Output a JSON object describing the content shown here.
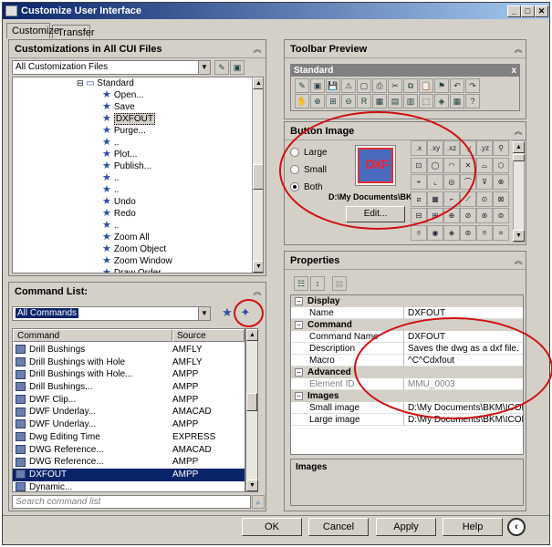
{
  "window": {
    "title": "Customize User Interface",
    "min": "_",
    "max": "□",
    "close": "✕"
  },
  "tabs": [
    "Customize",
    "Transfer"
  ],
  "customizations": {
    "header": "Customizations in All CUI Files",
    "file_combo": "All Customization Files",
    "tree_root": "Standard",
    "tree_items": [
      "Open...",
      "Save",
      "DXFOUT",
      "Purge...",
      "..",
      "Plot...",
      "Publish...",
      "..",
      "..",
      "Undo",
      "Redo",
      "..",
      "Zoom All",
      "Zoom Object",
      "Zoom Window",
      "Draw Order"
    ],
    "selected_index": 2
  },
  "command_list": {
    "header": "Command List:",
    "filter_combo": "All Commands",
    "col_command": "Command",
    "col_source": "Source",
    "rows": [
      {
        "command": "Drill Bushings",
        "source": "AMFLY"
      },
      {
        "command": "Drill Bushings with Hole",
        "source": "AMFLY"
      },
      {
        "command": "Drill Bushings with Hole...",
        "source": "AMPP"
      },
      {
        "command": "Drill Bushings...",
        "source": "AMPP"
      },
      {
        "command": "DWF Clip...",
        "source": "AMPP"
      },
      {
        "command": "DWF Underlay...",
        "source": "AMACAD"
      },
      {
        "command": "DWF Underlay...",
        "source": "AMPP"
      },
      {
        "command": "Dwg Editing Time",
        "source": "EXPRESS"
      },
      {
        "command": "DWG Reference...",
        "source": "AMACAD"
      },
      {
        "command": "DWG Reference...",
        "source": "AMPP"
      },
      {
        "command": "DXFOUT",
        "source": "AMPP"
      },
      {
        "command": "Dynamic...",
        "source": ""
      }
    ],
    "selected_index": 10,
    "search_placeholder": "Search command list"
  },
  "toolbar_preview": {
    "header": "Toolbar Preview",
    "toolbar_name": "Standard",
    "close": "x",
    "icons": [
      "new-icon",
      "open-icon",
      "save-icon",
      "plot-icon",
      "preview-icon",
      "publish-icon",
      "cut-icon",
      "copy-icon",
      "paste-icon",
      "matchprop-icon",
      "undo-icon",
      "redo-icon",
      "pan-icon",
      "zoom-realtime-icon",
      "zoom-window-icon",
      "zoom-prev-icon",
      "regen-icon",
      "sheetset-icon",
      "properties-icon",
      "designcenter-icon",
      "toolpalette-icon",
      "markup-icon",
      "calc-icon",
      "help-icon"
    ]
  },
  "button_image": {
    "header": "Button Image",
    "options": [
      "Large",
      "Small",
      "Both"
    ],
    "selected": "Both",
    "preview_text": "DXF",
    "path": "D:\\My Documents\\BK",
    "edit_label": "Edit...",
    "grid_labels": [
      ".x",
      ".xy",
      ".xz",
      ".y",
      ".yz",
      "",
      "",
      "",
      "",
      "",
      "",
      "",
      "",
      "",
      "",
      "",
      "",
      "",
      "",
      "",
      "",
      "",
      "",
      "",
      "",
      "",
      "",
      "",
      "",
      "",
      "",
      "",
      "",
      "",
      "",
      ""
    ]
  },
  "properties": {
    "header": "Properties",
    "groups": [
      {
        "name": "Display",
        "rows": [
          {
            "key": "Name",
            "value": "DXFOUT",
            "disabled": false
          }
        ]
      },
      {
        "name": "Command",
        "rows": [
          {
            "key": "Command Name",
            "value": "DXFOUT",
            "disabled": false
          },
          {
            "key": "Description",
            "value": "Saves the dwg as a dxf file.",
            "disabled": false
          },
          {
            "key": "Macro",
            "value": "^C^Cdxfout",
            "disabled": false
          }
        ]
      },
      {
        "name": "Advanced",
        "rows": [
          {
            "key": "Element ID",
            "value": "MMU_0003",
            "disabled": true
          }
        ]
      },
      {
        "name": "Images",
        "rows": [
          {
            "key": "Small image",
            "value": "D:\\My Documents\\BKM\\ICONS\\",
            "disabled": false
          },
          {
            "key": "Large image",
            "value": "D:\\My Documents\\BKM\\ICONS\\",
            "disabled": false
          }
        ]
      }
    ],
    "help_title": "Images"
  },
  "footer": {
    "ok": "OK",
    "cancel": "Cancel",
    "apply": "Apply",
    "help": "Help"
  }
}
